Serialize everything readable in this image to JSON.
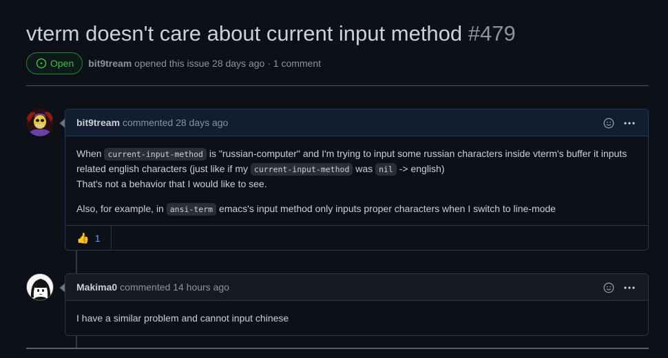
{
  "issue": {
    "title": "vterm doesn't care about current input method",
    "number": "#479",
    "state": "Open",
    "author": "bit9tream",
    "opened_text": "opened this issue 28 days ago",
    "separator": "·",
    "comment_count": "1 comment"
  },
  "comments": [
    {
      "author": "bit9tream",
      "meta": "commented 28 days ago",
      "avatar_icon": "skeletor-avatar",
      "body": {
        "p1_a": "When",
        "p1_code1": "current-input-method",
        "p1_b": "is \"russian-computer\" and I'm trying to input some russian characters inside vterm's buffer it inputs related english characters (just like if my",
        "p1_code2": "current-input-method",
        "p1_c": "was",
        "p1_code3": "nil",
        "p1_d": "-> english)",
        "p1_e": "That's not a behavior that I would like to see.",
        "p2_a": "Also, for example, in",
        "p2_code": "ansi-term",
        "p2_b": "emacs's input method only inputs proper characters when I switch to line-mode"
      },
      "reaction": {
        "icon": "thumbs-up-icon",
        "count": "1"
      }
    },
    {
      "author": "Makima0",
      "meta": "commented 14 hours ago",
      "avatar_icon": "anime-avatar",
      "body": {
        "p1": "I have a similar problem and cannot input chinese"
      }
    }
  ],
  "colors": {
    "background": "#0d1117",
    "open_green": "#3fb950",
    "link_blue": "#58a6ff",
    "muted": "#8b949e"
  }
}
